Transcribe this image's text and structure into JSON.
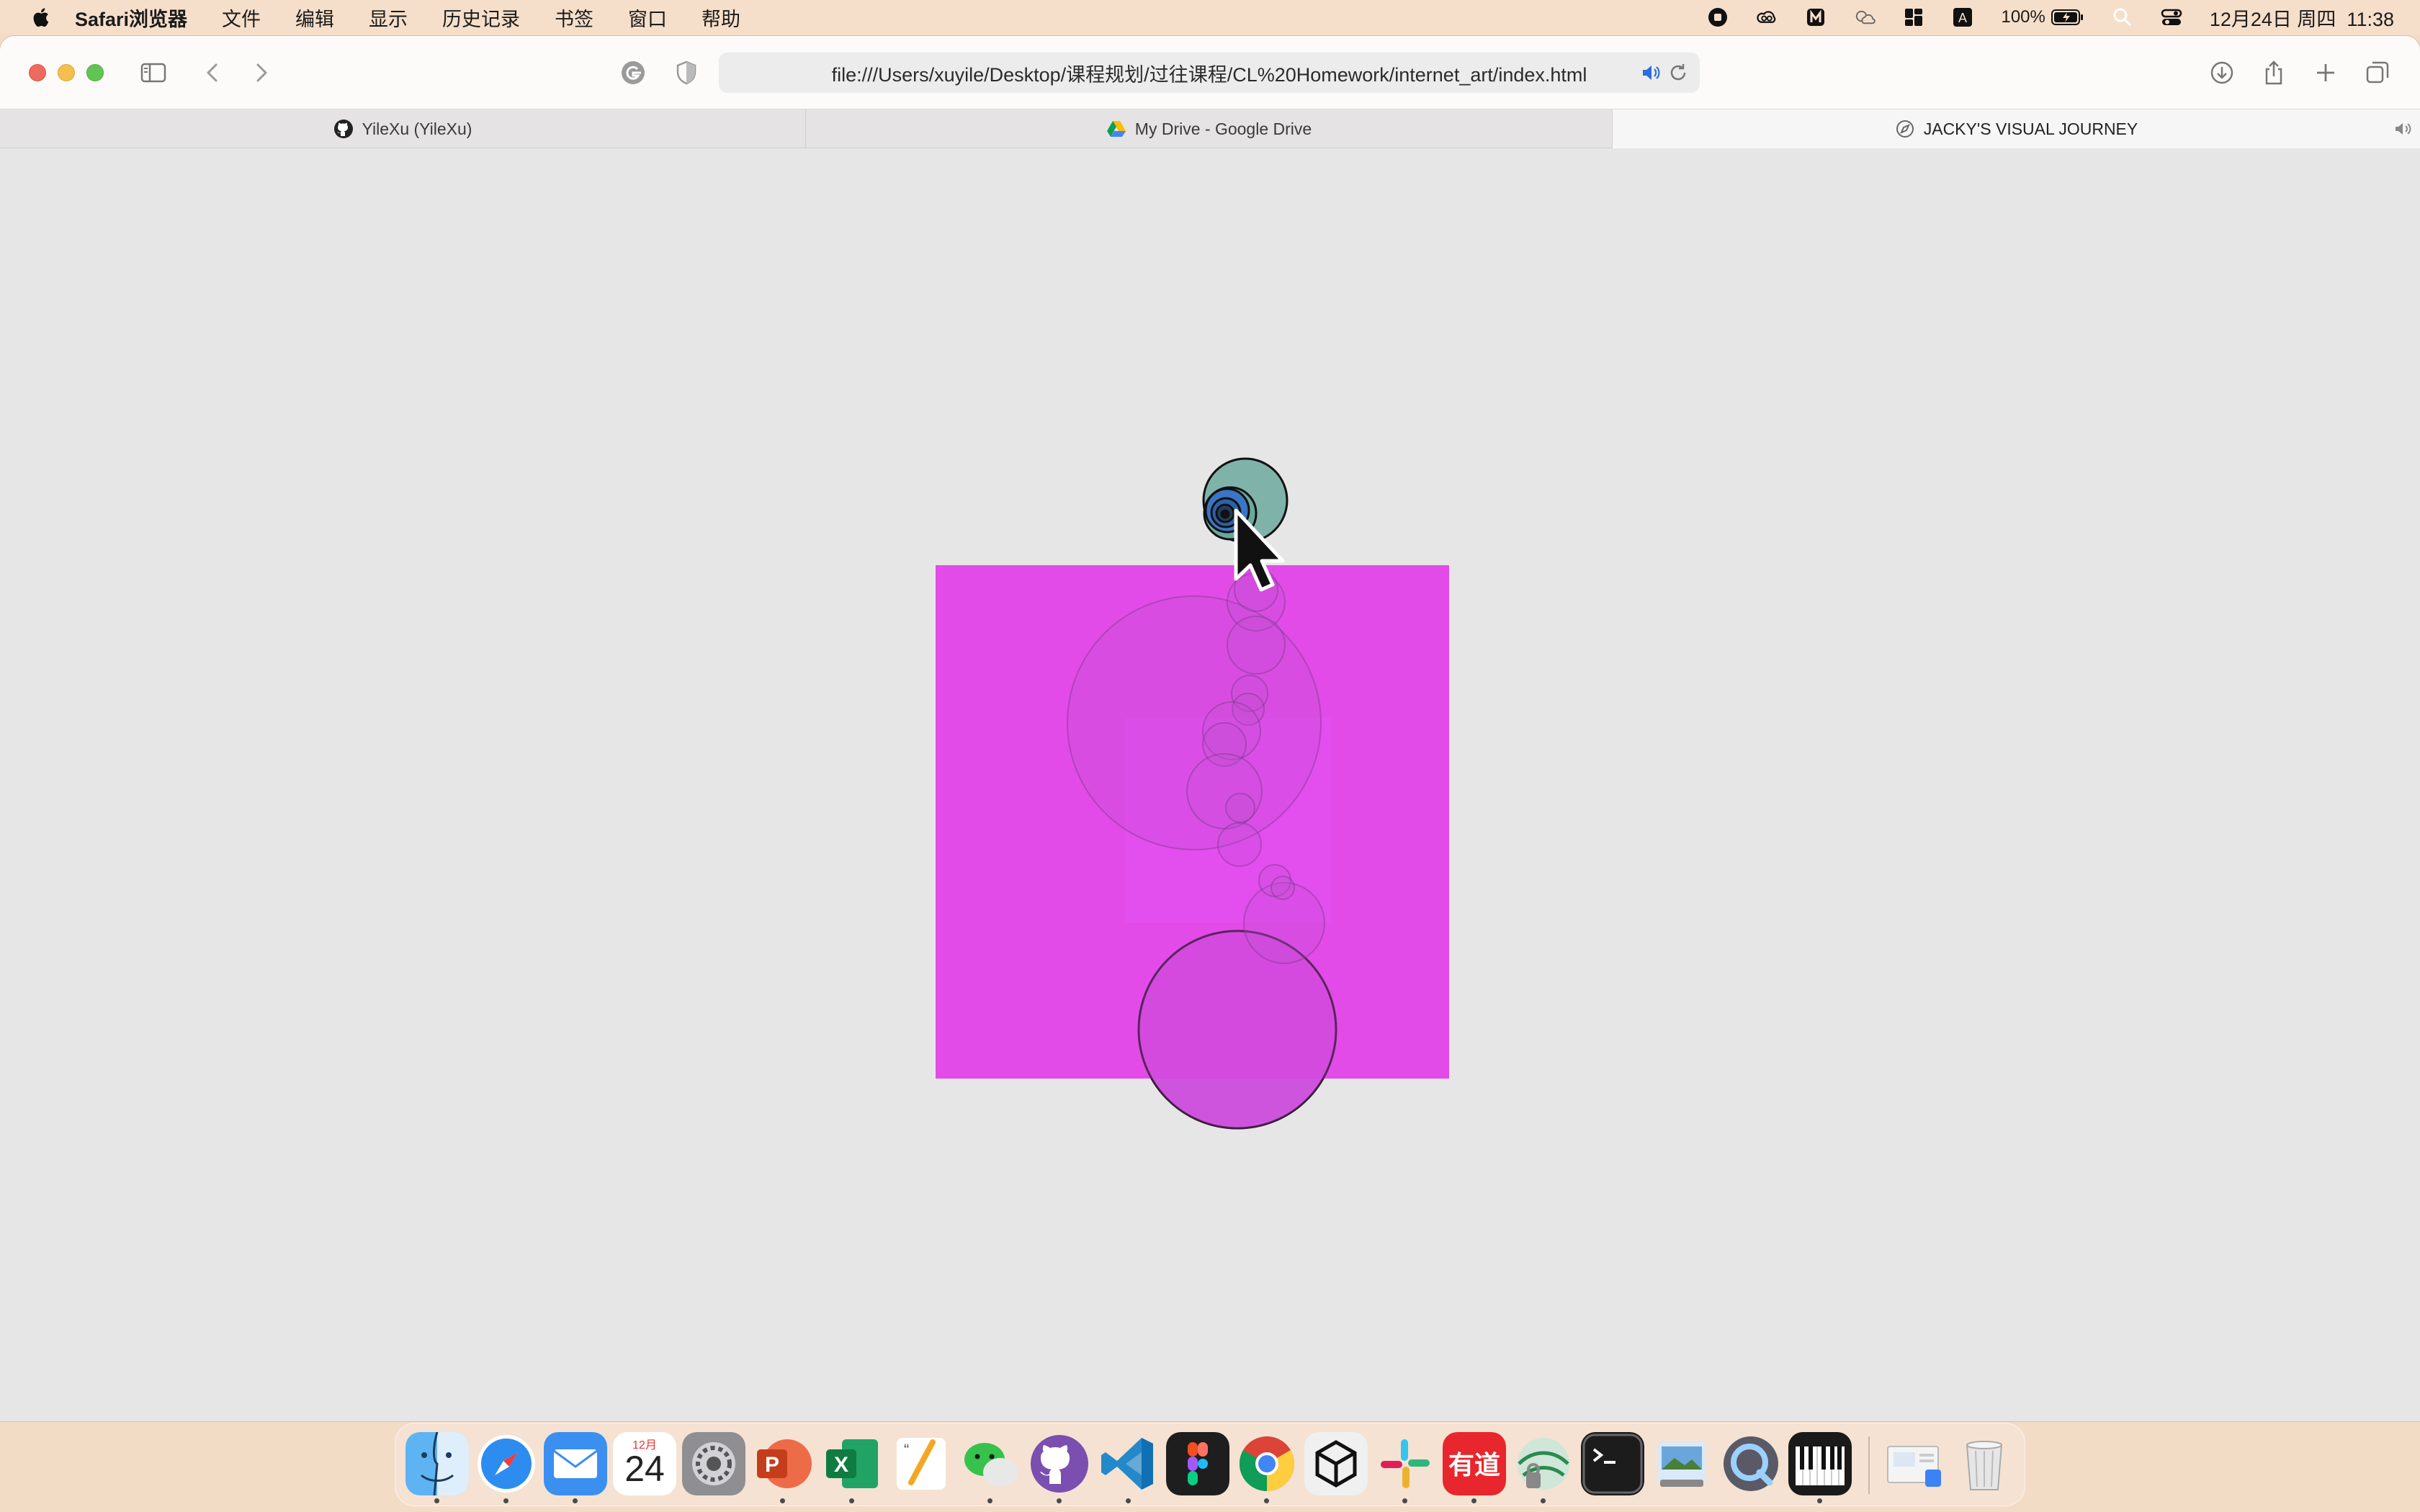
{
  "menubar": {
    "app_name": "Safari浏览器",
    "menus": [
      "文件",
      "编辑",
      "显示",
      "历史记录",
      "书签",
      "窗口",
      "帮助"
    ],
    "battery_percent": "100%",
    "datetime": "12月24日 周四  11:38",
    "status_icons": [
      "screen-record-icon",
      "creative-cloud-icon",
      "maccy-icon",
      "weather-icon",
      "grid-icon",
      "input-method-icon",
      "battery-icon",
      "search-icon",
      "control-center-icon"
    ]
  },
  "browser": {
    "url": "file:///Users/xuyile/Desktop/课程规划/过往课程/CL%20Homework/internet_art/index.html",
    "tabs": [
      {
        "title": "YileXu (YileXu)",
        "icon": "github-icon",
        "active": false
      },
      {
        "title": "My Drive - Google Drive",
        "icon": "google-drive-icon",
        "active": false
      },
      {
        "title": "JACKY'S VISUAL JOURNEY",
        "icon": "compass-icon",
        "active": true
      }
    ]
  },
  "art": {
    "background": "#e6e6e6",
    "square_color": "#e24be8",
    "circle_colors": [
      "#7fb3aa",
      "#3b76c4",
      "#8b9fd8",
      "#c85ad4"
    ]
  },
  "dock": {
    "calendar_month": "12月",
    "calendar_day": "24",
    "apps": [
      "Finder",
      "Safari",
      "Mail",
      "Calendar",
      "System Preferences",
      "PowerPoint",
      "Excel",
      "Pages",
      "WeChat",
      "GitHub Desktop",
      "VS Code",
      "Figma",
      "Chrome",
      "Unity",
      "Slack",
      "Youdao",
      "Network",
      "Terminal",
      "Preview",
      "QuickTime",
      "Piano",
      "Documents",
      "Trash"
    ]
  }
}
